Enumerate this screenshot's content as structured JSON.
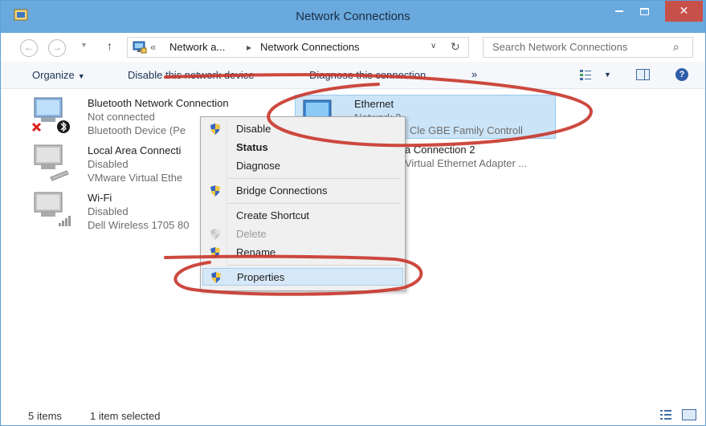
{
  "window": {
    "title": "Network Connections"
  },
  "address": {
    "overflow": "«",
    "crumb1": "Network a...",
    "crumb2": "Network Connections",
    "search_placeholder": "Search Network Connections"
  },
  "toolbar": {
    "organize": "Organize",
    "disable": "Disable this network device",
    "diagnose": "Diagnose this connection",
    "more": "»"
  },
  "connections": [
    {
      "name": "Bluetooth Network Connection",
      "status": "Not connected",
      "device": "Bluetooth Device (Pe"
    },
    {
      "name": "Local Area Connecti",
      "status": "Disabled",
      "device": "VMware Virtual Ethe"
    },
    {
      "name": "Wi-Fi",
      "status": "Disabled",
      "device": "Dell Wireless 1705 80"
    },
    {
      "name": "Ethernet",
      "status": "Network 2",
      "device": "Cle GBE Family Controll"
    },
    {
      "name": "a Connection 2",
      "status": "",
      "device": "Virtual Ethernet Adapter ..."
    }
  ],
  "context_menu": {
    "items": [
      {
        "label": "Disable"
      },
      {
        "label": "Status"
      },
      {
        "label": "Diagnose"
      },
      {
        "label": "Bridge Connections"
      },
      {
        "label": "Create Shortcut"
      },
      {
        "label": "Delete"
      },
      {
        "label": "Rename"
      },
      {
        "label": "Properties"
      }
    ]
  },
  "status": {
    "items": "5 items",
    "selected": "1 item selected"
  },
  "colors": {
    "titlebar": "#6aa9dd",
    "close": "#c7504a",
    "selection": "#cce4f7",
    "annotation": "#c8352a"
  }
}
